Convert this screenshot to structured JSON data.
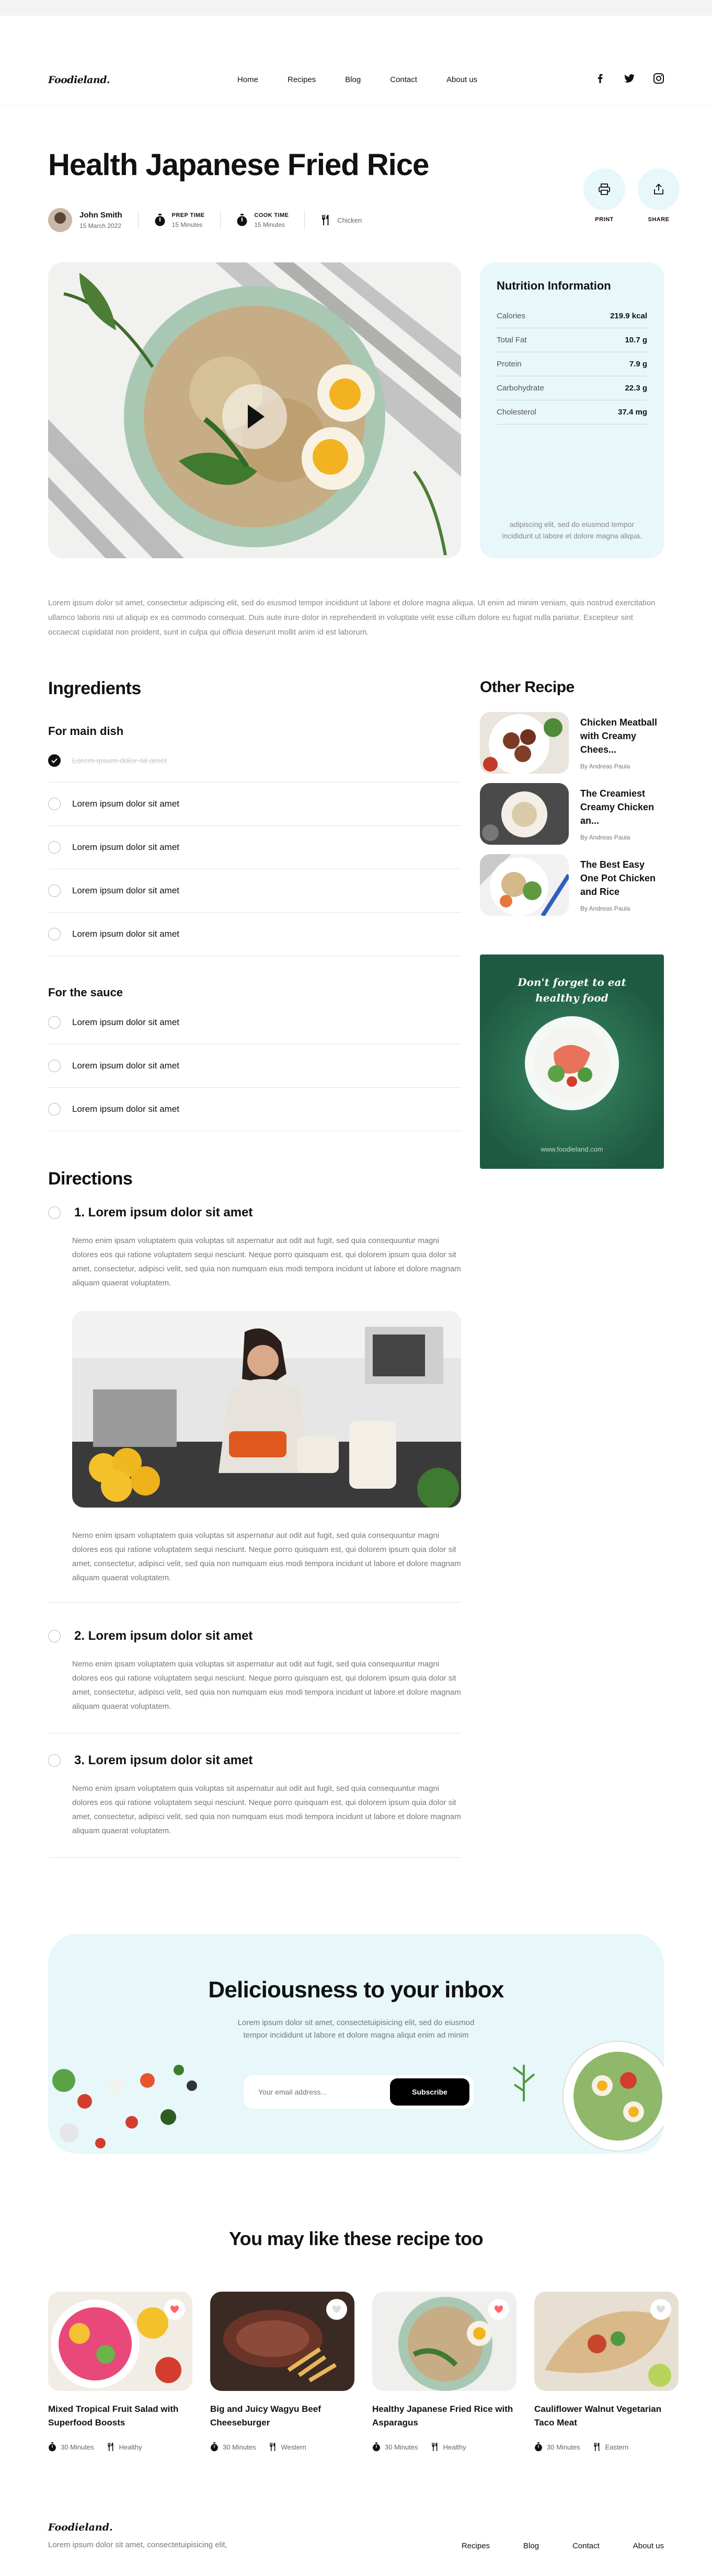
{
  "brand": {
    "logo": "Foodieland."
  },
  "nav": {
    "items": [
      "Home",
      "Recipes",
      "Blog",
      "Contact",
      "About us"
    ]
  },
  "social": [
    "facebook-icon",
    "twitter-icon",
    "instagram-icon"
  ],
  "recipe": {
    "title": "Health Japanese Fried Rice",
    "author": "John Smith",
    "date": "15 March 2022",
    "prep_label": "PREP TIME",
    "prep_value": "15 Minutes",
    "cook_label": "COOK TIME",
    "cook_value": "15 Minutes",
    "category": "Chicken",
    "print_label": "PRINT",
    "share_label": "SHARE",
    "description": "Lorem ipsum dolor sit amet, consectetur adipiscing elit, sed do eiusmod tempor incididunt ut labore et dolore magna aliqua. Ut enim ad minim veniam, quis nostrud exercitation ullamco laboris nisi ut aliquip ex ea commodo consequat. Duis aute irure dolor in reprehenderit in voluptate velit esse cillum dolore eu fugiat nulla pariatur. Excepteur sint occaecat cupidatat non proident, sunt in culpa qui officia deserunt mollit anim id est laborum."
  },
  "nutrition": {
    "title": "Nutrition Information",
    "rows": [
      {
        "label": "Calories",
        "value": "219.9 kcal"
      },
      {
        "label": "Total Fat",
        "value": "10.7 g"
      },
      {
        "label": "Protein",
        "value": "7.9 g"
      },
      {
        "label": "Carbohydrate",
        "value": "22.3 g"
      },
      {
        "label": "Cholesterol",
        "value": "37.4 mg"
      }
    ],
    "note": "adipiscing elit, sed do eiusmod tempor incididunt ut labore et dolore magna aliqua."
  },
  "ingredients": {
    "title": "Ingredients",
    "main_title": "For main dish",
    "main_items": [
      {
        "text": "Lorem ipsum dolor sit amet",
        "checked": true
      },
      {
        "text": "Lorem ipsum dolor sit amet",
        "checked": false
      },
      {
        "text": "Lorem ipsum dolor sit amet",
        "checked": false
      },
      {
        "text": "Lorem ipsum dolor sit amet",
        "checked": false
      },
      {
        "text": "Lorem ipsum dolor sit amet",
        "checked": false
      }
    ],
    "sauce_title": "For the sauce",
    "sauce_items": [
      {
        "text": "Lorem ipsum dolor sit amet"
      },
      {
        "text": "Lorem ipsum dolor sit amet"
      },
      {
        "text": "Lorem ipsum dolor sit amet"
      }
    ]
  },
  "other_recipes": {
    "title": "Other Recipe",
    "items": [
      {
        "title": "Chicken Meatball with Creamy Chees...",
        "author": "By Andreas Paula"
      },
      {
        "title": "The Creamiest Creamy Chicken an...",
        "author": "By Andreas Paula"
      },
      {
        "title": "The Best Easy One Pot Chicken and Rice",
        "author": "By Andreas Paula"
      }
    ]
  },
  "ad": {
    "slogan_line1": "Don't forget to eat",
    "slogan_line2": "healthy food",
    "site": "www.foodieland.com"
  },
  "directions": {
    "title": "Directions",
    "steps": [
      {
        "title": "1. Lorem ipsum dolor sit amet",
        "text": "Nemo enim ipsam voluptatem quia voluptas sit aspernatur aut odit aut fugit, sed quia consequuntur magni dolores eos qui ratione voluptatem sequi nesciunt. Neque porro quisquam est, qui dolorem ipsum quia dolor sit amet, consectetur, adipisci velit, sed quia non numquam eius modi tempora incidunt ut labore et dolore magnam aliquam quaerat voluptatem.",
        "text2": "Nemo enim ipsam voluptatem quia voluptas sit aspernatur aut odit aut fugit, sed quia consequuntur magni dolores eos qui ratione voluptatem sequi nesciunt. Neque porro quisquam est, qui dolorem ipsum quia dolor sit amet, consectetur, adipisci velit, sed quia non numquam eius modi tempora incidunt ut labore et dolore magnam aliquam quaerat voluptatem."
      },
      {
        "title": "2. Lorem ipsum dolor sit amet",
        "text": "Nemo enim ipsam voluptatem quia voluptas sit aspernatur aut odit aut fugit, sed quia consequuntur magni dolores eos qui ratione voluptatem sequi nesciunt. Neque porro quisquam est, qui dolorem ipsum quia dolor sit amet, consectetur, adipisci velit, sed quia non numquam eius modi tempora incidunt ut labore et dolore magnam aliquam quaerat voluptatem."
      },
      {
        "title": "3. Lorem ipsum dolor sit amet",
        "text": "Nemo enim ipsam voluptatem quia voluptas sit aspernatur aut odit aut fugit, sed quia consequuntur magni dolores eos qui ratione voluptatem sequi nesciunt. Neque porro quisquam est, qui dolorem ipsum quia dolor sit amet, consectetur, adipisci velit, sed quia non numquam eius modi tempora incidunt ut labore et dolore magnam aliquam quaerat voluptatem."
      }
    ]
  },
  "newsletter": {
    "title": "Deliciousness to your inbox",
    "text": "Lorem ipsum dolor sit amet, consectetuipisicing elit, sed do eiusmod tempor incididunt ut labore et dolore magna aliqut enim ad minim",
    "placeholder": "Your email address...",
    "button": "Subscribe"
  },
  "suggestions": {
    "title": "You may like these recipe too",
    "cards": [
      {
        "title": "Mixed Tropical Fruit Salad with Superfood Boosts",
        "time": "30 Minutes",
        "tag": "Healthy"
      },
      {
        "title": "Big and Juicy Wagyu Beef Cheeseburger",
        "time": "30 Minutes",
        "tag": "Western"
      },
      {
        "title": "Healthy Japanese Fried Rice with Asparagus",
        "time": "30 Minutes",
        "tag": "Healthy"
      },
      {
        "title": "Cauliflower Walnut Vegetarian Taco Meat",
        "time": "30 Minutes",
        "tag": "Eastern"
      }
    ]
  },
  "footer": {
    "logo": "Foodieland.",
    "tagline": "Lorem ipsum dolor sit amet, consectetuipisicing elit,",
    "links": [
      "Recipes",
      "Blog",
      "Contact",
      "About us"
    ]
  },
  "colors": {
    "accent_bg": "#e7f7fa",
    "ad_green": "#1e5a42",
    "text": "#111111",
    "muted": "#888888"
  }
}
